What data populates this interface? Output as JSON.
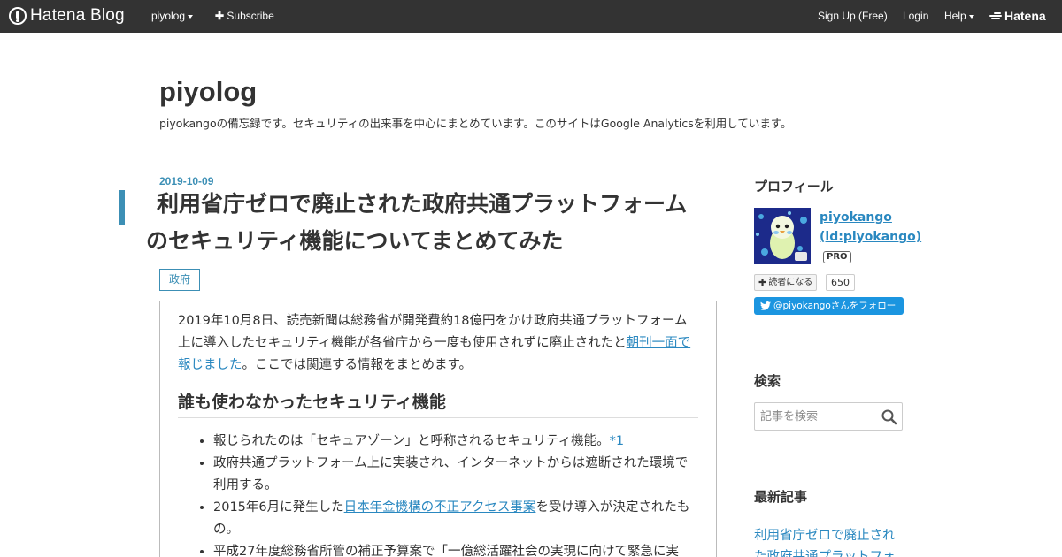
{
  "globalbar": {
    "logo_text": "Hatena Blog",
    "blog_menu": "piyolog",
    "subscribe": "Subscribe",
    "signup": "Sign Up (Free)",
    "login": "Login",
    "help": "Help",
    "hatena": "Hatena"
  },
  "header": {
    "title": "piyolog",
    "description": "piyokangoの備忘録です。セキュリティの出来事を中心にまとめています。このサイトはGoogle Analyticsを利用しています。"
  },
  "entry": {
    "date": "2019-10-09",
    "title_line1": "利用省庁ゼロで廃止された政府共通プラットフォーム",
    "title_line2": "のセキュリティ機能についてまとめてみた",
    "category": "政府",
    "intro_text1": "2019年10月8日、読売新聞は総務省が開発費約18億円をかけ政府共通プラットフォーム上に導入したセキュリティ機能が各省庁から一度も使用されずに廃止されたと",
    "intro_link": "朝刊一面で報じました",
    "intro_text2": "。ここでは関連する情報をまとめます。",
    "heading": "誰も使わなかったセキュリティ機能",
    "bullet1_text": "報じられたのは「セキュアゾーン」と呼称されるセキュリティ機能。",
    "bullet1_link": "*1",
    "bullet2_text": "政府共通プラットフォーム上に実装され、インターネットからは遮断された環境で利用する。",
    "bullet3_text1": "2015年6月に発生した",
    "bullet3_link": "日本年金機構の不正アクセス事案",
    "bullet3_text2": "を受け導入が決定されたもの。",
    "bullet4_text": "平成27年度総務省所管の補正予算案で「一億総活躍社会の実現に向けて緊急に実"
  },
  "sidebar": {
    "profile_heading": "プロフィール",
    "profile_name": "piyokango (id:piyokango)",
    "pro_badge": "PRO",
    "subscribe_label": "読者になる",
    "subscriber_count": "650",
    "twitter_label": "@piyokangoさんをフォロー",
    "search_heading": "検索",
    "search_placeholder": "記事を検索",
    "recent_heading": "最新記事",
    "recent_item1": "利用省庁ゼロで廃止された政府共通プラットフォ"
  },
  "colors": {
    "accent": "#3c8fb5",
    "link": "#2a88c0",
    "globalbar": "#333333",
    "twitter": "#1b95e0"
  }
}
